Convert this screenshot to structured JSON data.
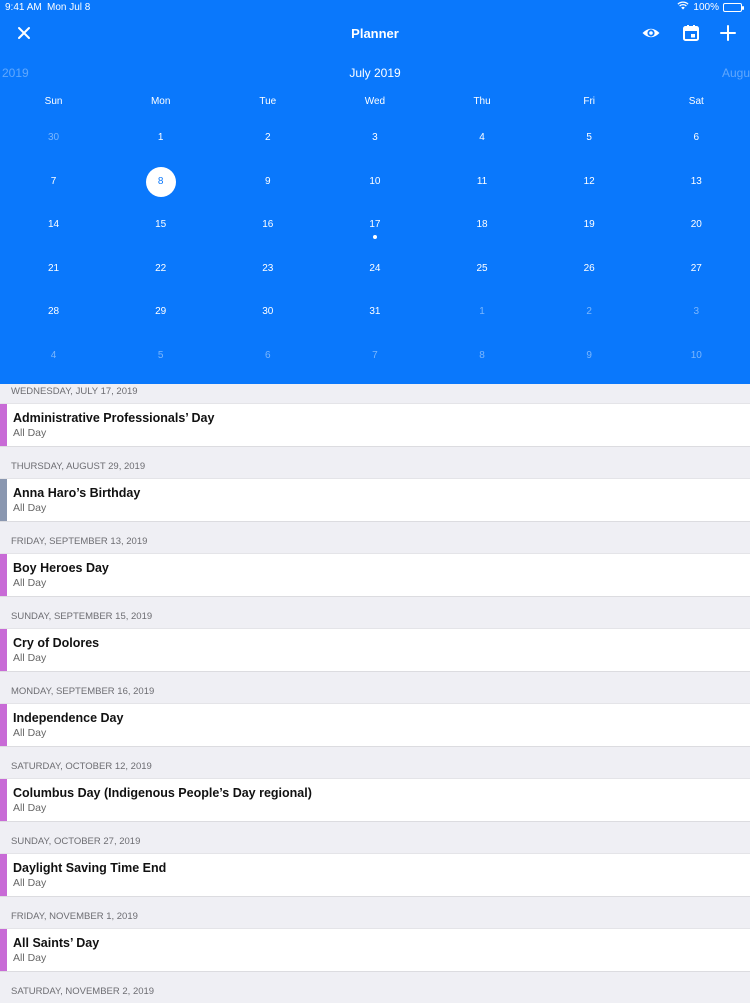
{
  "status": {
    "time": "9:41 AM",
    "date": "Mon Jul 8",
    "battery": "100%"
  },
  "nav": {
    "title": "Planner"
  },
  "calendar": {
    "prev_month": "2019",
    "current_month": "July 2019",
    "next_month": "Augus",
    "weekdays": [
      "Sun",
      "Mon",
      "Tue",
      "Wed",
      "Thu",
      "Fri",
      "Sat"
    ],
    "weeks": [
      [
        "30",
        "1",
        "2",
        "3",
        "4",
        "5",
        "6"
      ],
      [
        "7",
        "8",
        "9",
        "10",
        "11",
        "12",
        "13"
      ],
      [
        "14",
        "15",
        "16",
        "17",
        "18",
        "19",
        "20"
      ],
      [
        "21",
        "22",
        "23",
        "24",
        "25",
        "26",
        "27"
      ],
      [
        "28",
        "29",
        "30",
        "31",
        "1",
        "2",
        "3"
      ],
      [
        "4",
        "5",
        "6",
        "7",
        "8",
        "9",
        "10"
      ]
    ]
  },
  "colors": {
    "brand_blue": "#0a78fc",
    "holiday_purple": "#c86bd6",
    "birthday_slate": "#8a97b0"
  },
  "events": [
    {
      "date": "Wednesday, July 17, 2019",
      "title": "Administrative Professionals’ Day",
      "time": "All Day",
      "color": "#c86bd6"
    },
    {
      "date": "Thursday, August 29, 2019",
      "title": "Anna Haro’s Birthday",
      "time": "All Day",
      "color": "#8a97b0"
    },
    {
      "date": "Friday, September 13, 2019",
      "title": "Boy Heroes Day",
      "time": "All Day",
      "color": "#c86bd6"
    },
    {
      "date": "Sunday, September 15, 2019",
      "title": "Cry of Dolores",
      "time": "All Day",
      "color": "#c86bd6"
    },
    {
      "date": "Monday, September 16, 2019",
      "title": "Independence Day",
      "time": "All Day",
      "color": "#c86bd6"
    },
    {
      "date": "Saturday, October 12, 2019",
      "title": "Columbus Day (Indigenous People’s Day regional)",
      "time": "All Day",
      "color": "#c86bd6"
    },
    {
      "date": "Sunday, October 27, 2019",
      "title": "Daylight Saving Time End",
      "time": "All Day",
      "color": "#c86bd6"
    },
    {
      "date": "Friday, November 1, 2019",
      "title": "All Saints’ Day",
      "time": "All Day",
      "color": "#c86bd6"
    }
  ],
  "trailing_section": "Saturday, November 2, 2019"
}
